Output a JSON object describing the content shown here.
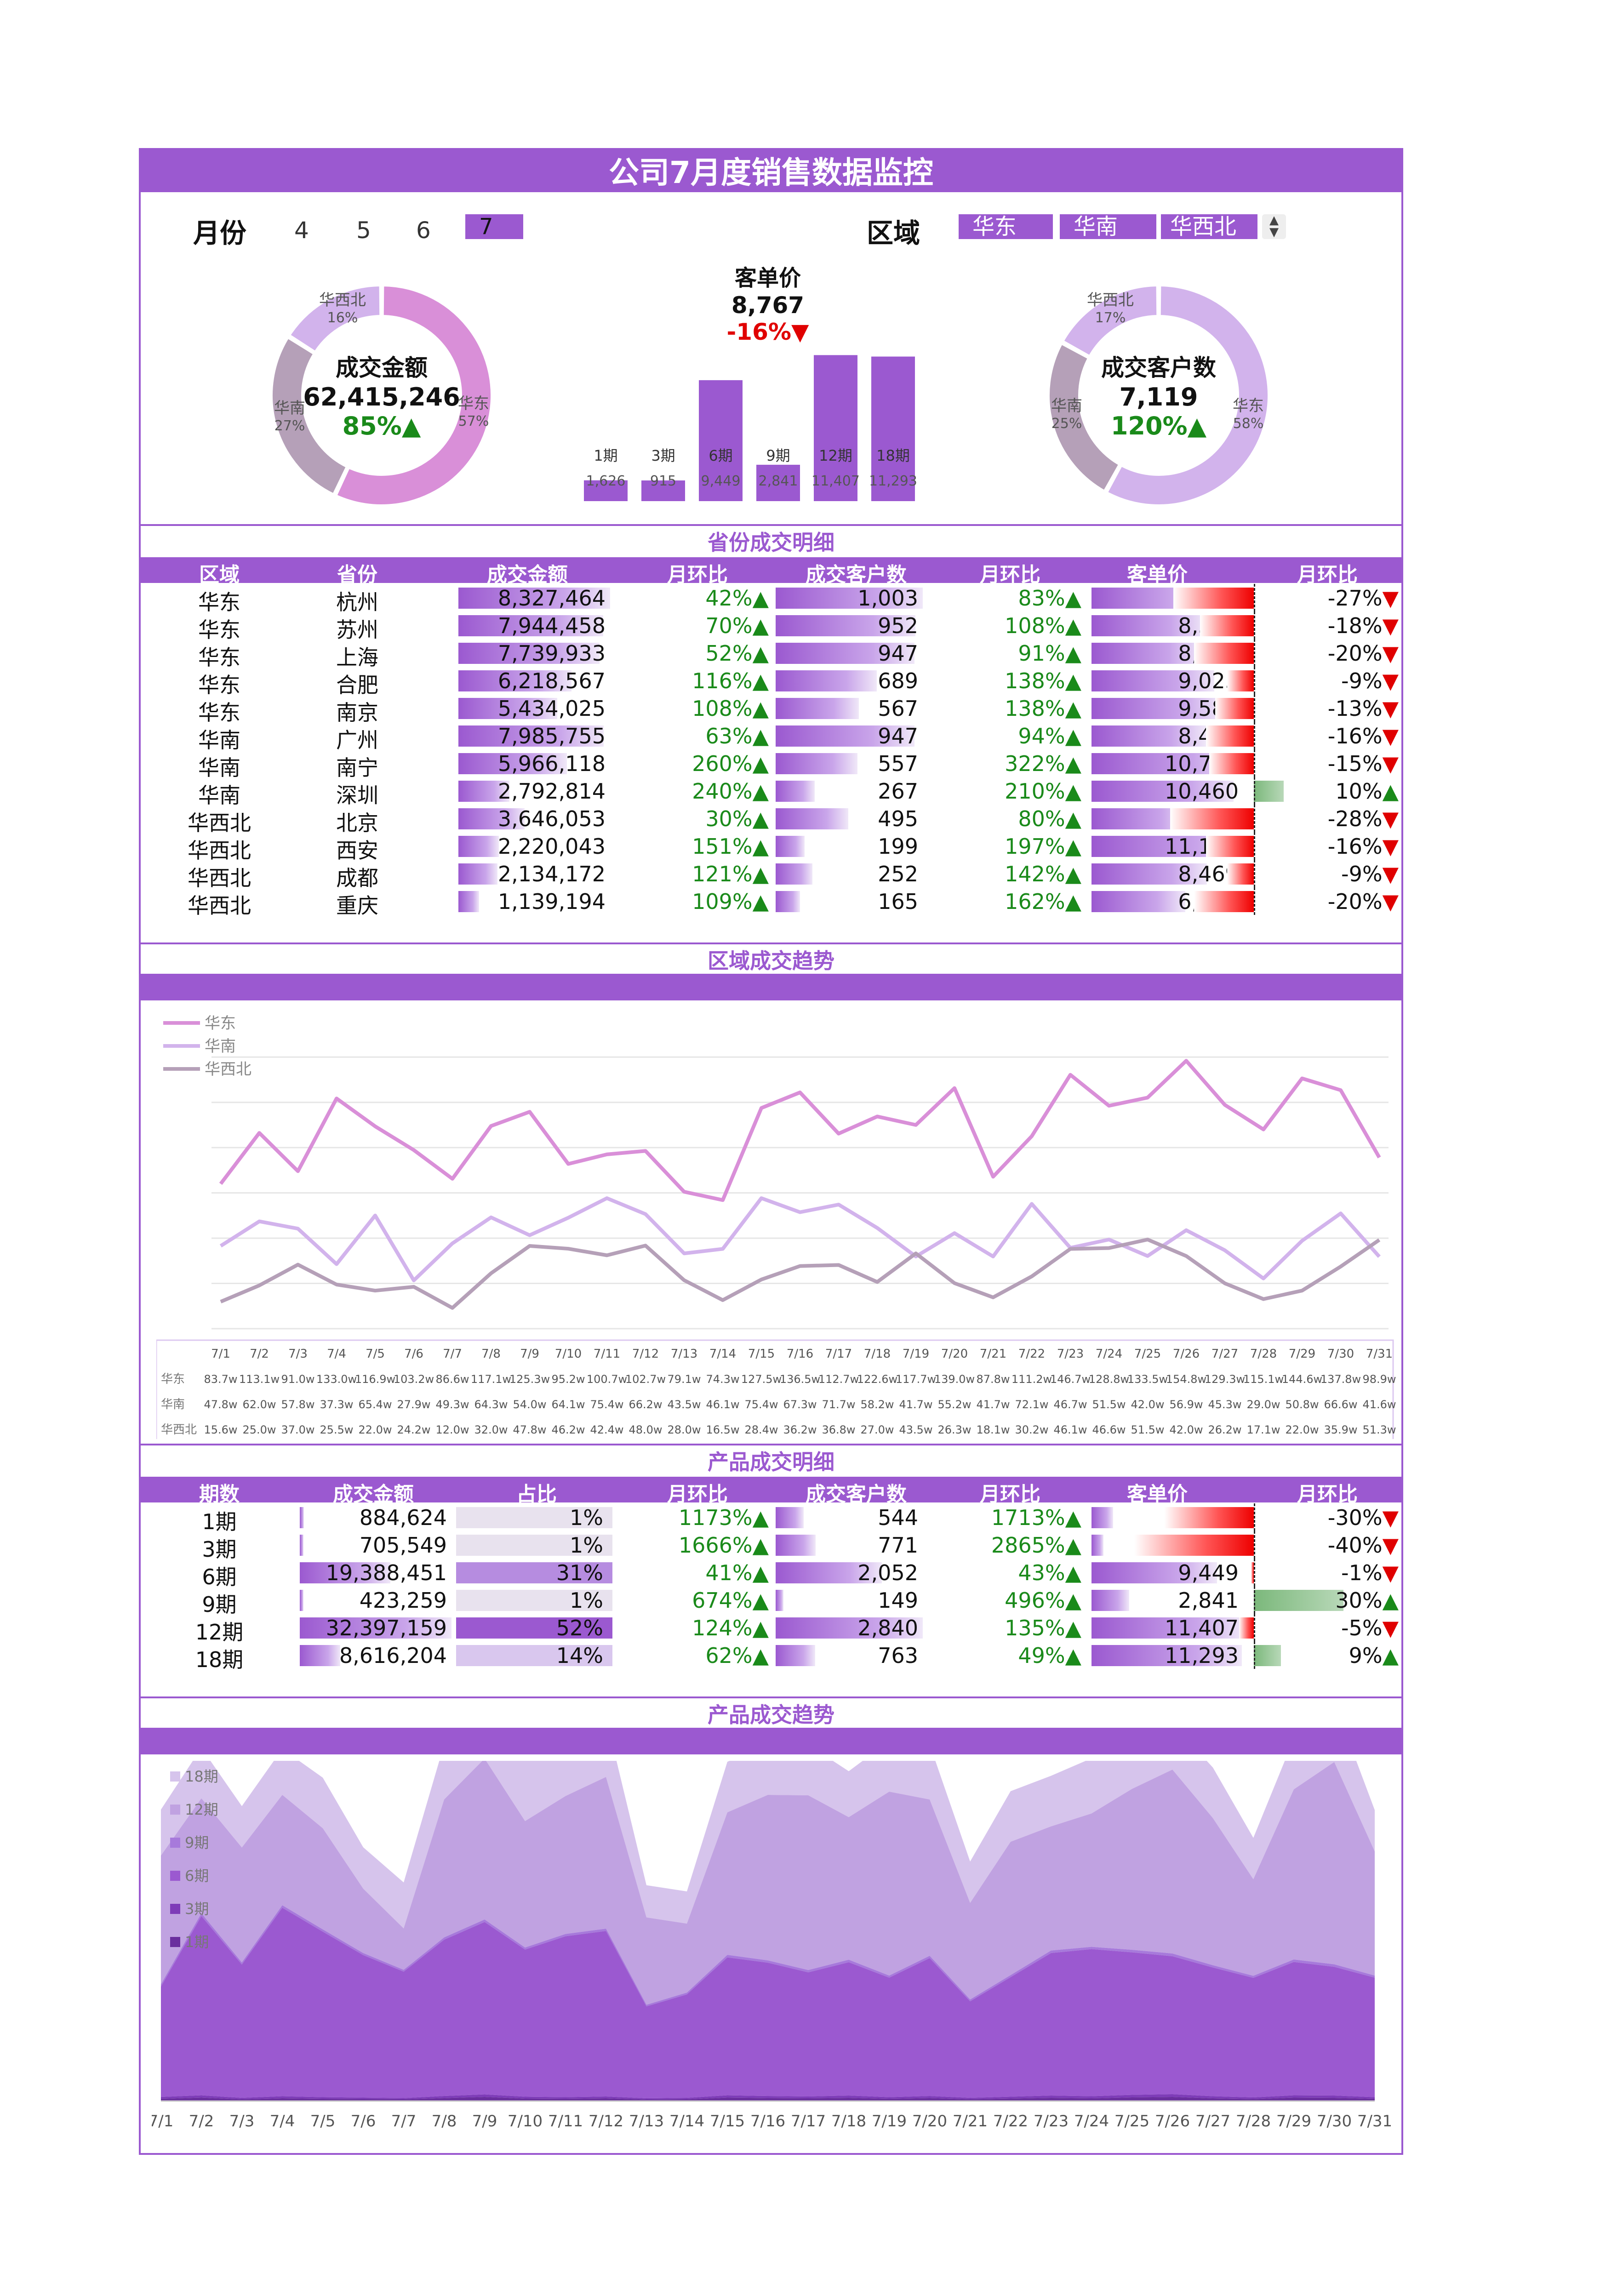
{
  "title": "公司7月度销售数据监控",
  "filters": {
    "month_label": "月份",
    "months": [
      "4",
      "5",
      "6",
      "7"
    ],
    "selected_month": "7",
    "region_label": "区域",
    "regions": [
      "华东",
      "华南",
      "华西北"
    ]
  },
  "kpi": {
    "amount": {
      "label": "成交金额",
      "value": "62,415,246",
      "change": "85%▲",
      "segments": [
        {
          "name": "华东",
          "pct": "57%",
          "share": 0.57
        },
        {
          "name": "华南",
          "pct": "27%",
          "share": 0.27
        },
        {
          "name": "华西北",
          "pct": "16%",
          "share": 0.16
        }
      ]
    },
    "avg_price": {
      "label": "客单价",
      "value": "8,767",
      "change": "-16%▼"
    },
    "customers": {
      "label": "成交客户数",
      "value": "7,119",
      "change": "120%▲",
      "segments": [
        {
          "name": "华东",
          "pct": "58%",
          "share": 0.58
        },
        {
          "name": "华南",
          "pct": "25%",
          "share": 0.25
        },
        {
          "name": "华西北",
          "pct": "17%",
          "share": 0.17
        }
      ]
    }
  },
  "colors": {
    "accent": "#9B59D0",
    "east": "#D98FD8",
    "south": "#D2B3EC",
    "northwest": "#B5A0B8",
    "good": "#1A8A1A",
    "bad": "#E00000"
  },
  "sections": {
    "province": "省份成交明细",
    "region_trend": "区域成交趋势",
    "product": "产品成交明细",
    "product_trend": "产品成交趋势"
  },
  "province_headers": [
    "区域",
    "省份",
    "成交金额",
    "月环比",
    "成交客户数",
    "月环比",
    "客单价",
    "月环比"
  ],
  "province_rows": [
    {
      "region": "华东",
      "province": "杭州",
      "amount": "8,327,464",
      "amt_mom": "42%▲",
      "cust": "1,003",
      "cust_mom": "83%▲",
      "price": "8,303",
      "price_mom": "-27%▼",
      "amt_v": 8327464,
      "cust_v": 1003,
      "price_v": 8303,
      "pm_v": -27
    },
    {
      "region": "华东",
      "province": "苏州",
      "amount": "7,944,458",
      "amt_mom": "70%▲",
      "cust": "952",
      "cust_mom": "108%▲",
      "price": "8,345",
      "price_mom": "-18%▼",
      "amt_v": 7944458,
      "cust_v": 952,
      "price_v": 8345,
      "pm_v": -18
    },
    {
      "region": "华东",
      "province": "上海",
      "amount": "7,739,933",
      "amt_mom": "52%▲",
      "cust": "947",
      "cust_mom": "91%▲",
      "price": "8,173",
      "price_mom": "-20%▼",
      "amt_v": 7739933,
      "cust_v": 947,
      "price_v": 8173,
      "pm_v": -20
    },
    {
      "region": "华东",
      "province": "合肥",
      "amount": "6,218,567",
      "amt_mom": "116%▲",
      "cust": "689",
      "cust_mom": "138%▲",
      "price": "9,025",
      "price_mom": "-9%▼",
      "amt_v": 6218567,
      "cust_v": 689,
      "price_v": 9025,
      "pm_v": -9
    },
    {
      "region": "华东",
      "province": "南京",
      "amount": "5,434,025",
      "amt_mom": "108%▲",
      "cust": "567",
      "cust_mom": "138%▲",
      "price": "9,584",
      "price_mom": "-13%▼",
      "amt_v": 5434025,
      "cust_v": 567,
      "price_v": 9584,
      "pm_v": -13
    },
    {
      "region": "华南",
      "province": "广州",
      "amount": "7,985,755",
      "amt_mom": "63%▲",
      "cust": "947",
      "cust_mom": "94%▲",
      "price": "8,433",
      "price_mom": "-16%▼",
      "amt_v": 7985755,
      "cust_v": 947,
      "price_v": 8433,
      "pm_v": -16
    },
    {
      "region": "华南",
      "province": "南宁",
      "amount": "5,966,118",
      "amt_mom": "260%▲",
      "cust": "557",
      "cust_mom": "322%▲",
      "price": "10,711",
      "price_mom": "-15%▼",
      "amt_v": 5966118,
      "cust_v": 557,
      "price_v": 10711,
      "pm_v": -15
    },
    {
      "region": "华南",
      "province": "深圳",
      "amount": "2,792,814",
      "amt_mom": "240%▲",
      "cust": "267",
      "cust_mom": "210%▲",
      "price": "10,460",
      "price_mom": "10%▲",
      "amt_v": 2792814,
      "cust_v": 267,
      "price_v": 10460,
      "pm_v": 10
    },
    {
      "region": "华西北",
      "province": "北京",
      "amount": "3,646,053",
      "amt_mom": "30%▲",
      "cust": "495",
      "cust_mom": "80%▲",
      "price": "7,366",
      "price_mom": "-28%▼",
      "amt_v": 3646053,
      "cust_v": 495,
      "price_v": 7366,
      "pm_v": -28
    },
    {
      "region": "华西北",
      "province": "西安",
      "amount": "2,220,043",
      "amt_mom": "151%▲",
      "cust": "199",
      "cust_mom": "197%▲",
      "price": "11,156",
      "price_mom": "-16%▼",
      "amt_v": 2220043,
      "cust_v": 199,
      "price_v": 11156,
      "pm_v": -16
    },
    {
      "region": "华西北",
      "province": "成都",
      "amount": "2,134,172",
      "amt_mom": "121%▲",
      "cust": "252",
      "cust_mom": "142%▲",
      "price": "8,469",
      "price_mom": "-9%▼",
      "amt_v": 2134172,
      "cust_v": 252,
      "price_v": 8469,
      "pm_v": -9
    },
    {
      "region": "华西北",
      "province": "重庆",
      "amount": "1,139,194",
      "amt_mom": "109%▲",
      "cust": "165",
      "cust_mom": "162%▲",
      "price": "6,904",
      "price_mom": "-20%▼",
      "amt_v": 1139194,
      "cust_v": 165,
      "price_v": 6904,
      "pm_v": -20
    }
  ],
  "product_headers": [
    "期数",
    "成交金额",
    "占比",
    "月环比",
    "成交客户数",
    "月环比",
    "客单价",
    "月环比"
  ],
  "product_rows": [
    {
      "period": "1期",
      "amount": "884,624",
      "share": "1%",
      "amt_mom": "1173%▲",
      "cust": "544",
      "cust_mom": "1713%▲",
      "price": "1,626",
      "price_mom": "-30%▼",
      "amt_v": 884624,
      "share_v": 1,
      "cust_v": 544,
      "price_v": 1626,
      "pm_v": -30
    },
    {
      "period": "3期",
      "amount": "705,549",
      "share": "1%",
      "amt_mom": "1666%▲",
      "cust": "771",
      "cust_mom": "2865%▲",
      "price": "915",
      "price_mom": "-40%▼",
      "amt_v": 705549,
      "share_v": 1,
      "cust_v": 771,
      "price_v": 915,
      "pm_v": -40
    },
    {
      "period": "6期",
      "amount": "19,388,451",
      "share": "31%",
      "amt_mom": "41%▲",
      "cust": "2,052",
      "cust_mom": "43%▲",
      "price": "9,449",
      "price_mom": "-1%▼",
      "amt_v": 19388451,
      "share_v": 31,
      "cust_v": 2052,
      "price_v": 9449,
      "pm_v": -1
    },
    {
      "period": "9期",
      "amount": "423,259",
      "share": "1%",
      "amt_mom": "674%▲",
      "cust": "149",
      "cust_mom": "496%▲",
      "price": "2,841",
      "price_mom": "30%▲",
      "amt_v": 423259,
      "share_v": 1,
      "cust_v": 149,
      "price_v": 2841,
      "pm_v": 30
    },
    {
      "period": "12期",
      "amount": "32,397,159",
      "share": "52%",
      "amt_mom": "124%▲",
      "cust": "2,840",
      "cust_mom": "135%▲",
      "price": "11,407",
      "price_mom": "-5%▼",
      "amt_v": 32397159,
      "share_v": 52,
      "cust_v": 2840,
      "price_v": 11407,
      "pm_v": -5
    },
    {
      "period": "18期",
      "amount": "8,616,204",
      "share": "14%",
      "amt_mom": "62%▲",
      "cust": "763",
      "cust_mom": "49%▲",
      "price": "11,293",
      "price_mom": "9%▲",
      "amt_v": 8616204,
      "share_v": 14,
      "cust_v": 763,
      "price_v": 11293,
      "pm_v": 9
    }
  ],
  "chart_data": [
    {
      "type": "bar",
      "title": "客单价",
      "categories": [
        "1期",
        "3期",
        "6期",
        "9期",
        "12期",
        "18期"
      ],
      "values": [
        1626,
        915,
        9449,
        2841,
        11407,
        11293
      ],
      "value_labels": [
        "1,626",
        "915",
        "9,449",
        "2,841",
        "11,407",
        "11,293"
      ],
      "ylim": [
        0,
        14500
      ]
    },
    {
      "type": "line",
      "title": "区域成交趋势",
      "categories": [
        "7/1",
        "7/2",
        "7/3",
        "7/4",
        "7/5",
        "7/6",
        "7/7",
        "7/8",
        "7/9",
        "7/10",
        "7/11",
        "7/12",
        "7/13",
        "7/14",
        "7/15",
        "7/16",
        "7/17",
        "7/18",
        "7/19",
        "7/20",
        "7/21",
        "7/22",
        "7/23",
        "7/24",
        "7/25",
        "7/26",
        "7/27",
        "7/28",
        "7/29",
        "7/30",
        "7/31"
      ],
      "series": [
        {
          "name": "华东",
          "color": "#D98FD8",
          "values": [
            83.7,
            113.1,
            91.0,
            133.0,
            116.9,
            103.2,
            86.6,
            117.1,
            125.3,
            95.2,
            100.7,
            102.7,
            79.1,
            74.3,
            127.5,
            136.5,
            112.7,
            122.6,
            117.7,
            139.0,
            87.8,
            111.2,
            146.7,
            128.8,
            133.5,
            154.8,
            129.3,
            115.1,
            144.6,
            137.8,
            98.9
          ],
          "labels": [
            "83.7w",
            "113.1w",
            "91.0w",
            "133.0w",
            "116.9w",
            "103.2w",
            "86.6w",
            "117.1w",
            "125.3w",
            "95.2w",
            "100.7w",
            "102.7w",
            "79.1w",
            "74.3w",
            "127.5w",
            "136.5w",
            "112.7w",
            "122.6w",
            "117.7w",
            "139.0w",
            "87.8w",
            "111.2w",
            "146.7w",
            "128.8w",
            "133.5w",
            "154.8w",
            "129.3w",
            "115.1w",
            "144.6w",
            "137.8w",
            "98.9w"
          ]
        },
        {
          "name": "华南",
          "color": "#D2B3EC",
          "values": [
            47.8,
            62.0,
            57.8,
            37.3,
            65.4,
            27.9,
            49.3,
            64.3,
            54.0,
            64.1,
            75.4,
            66.2,
            43.5,
            46.1,
            75.4,
            67.3,
            71.7,
            58.2,
            41.7,
            55.2,
            41.7,
            72.1,
            46.7,
            51.5,
            42.0,
            56.9,
            45.3,
            29.0,
            50.8,
            66.6,
            41.6
          ],
          "labels": [
            "47.8w",
            "62.0w",
            "57.8w",
            "37.3w",
            "65.4w",
            "27.9w",
            "49.3w",
            "64.3w",
            "54.0w",
            "64.1w",
            "75.4w",
            "66.2w",
            "43.5w",
            "46.1w",
            "75.4w",
            "67.3w",
            "71.7w",
            "58.2w",
            "41.7w",
            "55.2w",
            "41.7w",
            "72.1w",
            "46.7w",
            "51.5w",
            "42.0w",
            "56.9w",
            "45.3w",
            "29.0w",
            "50.8w",
            "66.6w",
            "41.6w"
          ]
        },
        {
          "name": "华西北",
          "color": "#B5A0B8",
          "values": [
            15.6,
            25.0,
            37.0,
            25.5,
            22.0,
            24.2,
            12.0,
            32.0,
            47.8,
            46.2,
            42.4,
            48.0,
            28.0,
            16.5,
            28.4,
            36.2,
            36.8,
            27.0,
            43.5,
            26.3,
            18.1,
            30.2,
            46.1,
            46.6,
            51.5,
            42.0,
            26.2,
            17.1,
            22.0,
            35.9,
            51.3
          ],
          "labels": [
            "15.6w",
            "25.0w",
            "37.0w",
            "25.5w",
            "22.0w",
            "24.2w",
            "12.0w",
            "32.0w",
            "47.8w",
            "46.2w",
            "42.4w",
            "48.0w",
            "28.0w",
            "16.5w",
            "28.4w",
            "36.2w",
            "36.8w",
            "27.0w",
            "43.5w",
            "26.3w",
            "18.1w",
            "30.2w",
            "46.1w",
            "46.6w",
            "51.5w",
            "42.0w",
            "26.2w",
            "17.1w",
            "22.0w",
            "35.9w",
            "51.3w"
          ]
        }
      ]
    },
    {
      "type": "area",
      "title": "产品成交趋势",
      "categories": [
        "7/1",
        "7/2",
        "7/3",
        "7/4",
        "7/5",
        "7/6",
        "7/7",
        "7/8",
        "7/9",
        "7/10",
        "7/11",
        "7/12",
        "7/13",
        "7/14",
        "7/15",
        "7/16",
        "7/17",
        "7/18",
        "7/19",
        "7/20",
        "7/21",
        "7/22",
        "7/23",
        "7/24",
        "7/25",
        "7/26",
        "7/27",
        "7/28",
        "7/29",
        "7/30",
        "7/31"
      ],
      "series": [
        {
          "name": "1期",
          "color": "#6A2E9E",
          "values": [
            1.0,
            1.5,
            0.8,
            1.2,
            1.0,
            0.9,
            0.8,
            1.3,
            1.8,
            1.1,
            1.0,
            1.2,
            0.7,
            0.8,
            1.5,
            1.3,
            1.2,
            1.4,
            1.0,
            1.3,
            0.8,
            1.1,
            1.4,
            1.2,
            1.6,
            1.8,
            1.2,
            0.9,
            1.5,
            1.4,
            1.0
          ]
        },
        {
          "name": "3期",
          "color": "#7E3CB8",
          "values": [
            0.8,
            1.0,
            0.6,
            0.9,
            0.7,
            0.6,
            0.5,
            0.9,
            1.1,
            0.8,
            0.7,
            0.8,
            0.5,
            0.6,
            1.0,
            0.9,
            0.8,
            1.0,
            0.7,
            0.9,
            0.6,
            0.8,
            1.0,
            0.9,
            1.1,
            1.2,
            0.9,
            0.7,
            1.0,
            1.0,
            0.7
          ]
        },
        {
          "name": "6期",
          "color": "#9B59D0",
          "values": [
            48,
            78,
            58,
            82,
            72,
            62,
            55,
            68,
            75,
            64,
            70,
            72,
            40,
            45,
            60,
            58,
            54,
            58,
            52,
            60,
            42,
            52,
            62,
            64,
            62,
            60,
            56,
            52,
            58,
            56,
            52
          ]
        },
        {
          "name": "9期",
          "color": "#A77ADB",
          "values": [
            1.0,
            1.2,
            0.9,
            1.1,
            1.0,
            0.9,
            0.8,
            1.0,
            1.1,
            0.9,
            1.0,
            1.0,
            0.7,
            0.8,
            1.1,
            1.0,
            1.0,
            1.1,
            0.9,
            1.0,
            0.8,
            0.9,
            1.1,
            1.0,
            1.1,
            1.2,
            1.0,
            0.9,
            1.1,
            1.1,
            0.9
          ]
        },
        {
          "name": "12期",
          "color": "#C0A2E1",
          "values": [
            56,
            50,
            50,
            48,
            44,
            28,
            18,
            60,
            70,
            55,
            60,
            66,
            38,
            30,
            62,
            72,
            76,
            62,
            80,
            68,
            42,
            58,
            54,
            58,
            70,
            80,
            64,
            42,
            74,
            88,
            54
          ]
        },
        {
          "name": "18期",
          "color": "#D6C4EC",
          "values": [
            20,
            22,
            18,
            20,
            22,
            18,
            20,
            24,
            22,
            30,
            28,
            26,
            14,
            14,
            22,
            22,
            22,
            20,
            22,
            24,
            18,
            22,
            22,
            24,
            20,
            20,
            22,
            18,
            22,
            26,
            18
          ]
        }
      ]
    }
  ]
}
